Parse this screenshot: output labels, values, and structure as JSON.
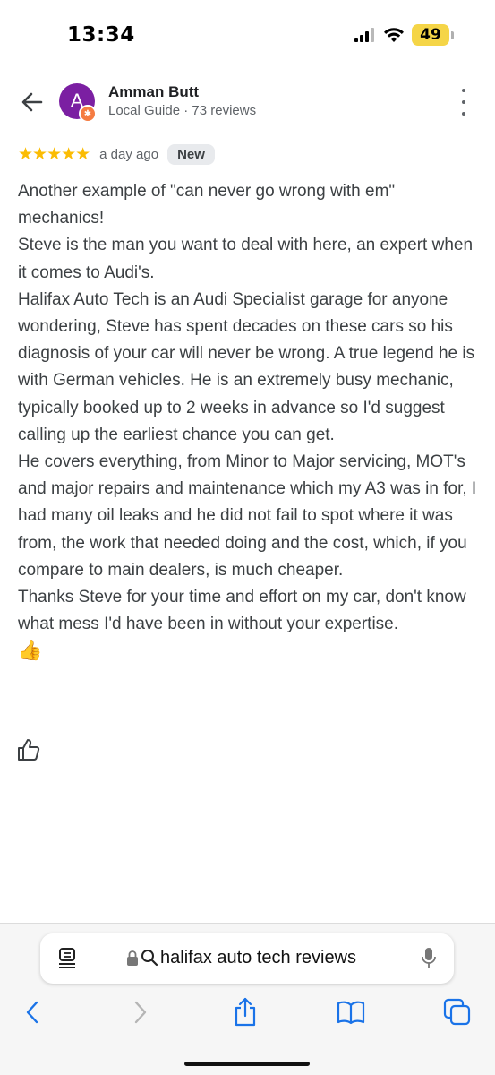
{
  "status_bar": {
    "time": "13:34",
    "battery": "49"
  },
  "reviewer": {
    "avatar_letter": "A",
    "name": "Amman Butt",
    "meta": "Local Guide · 73 reviews"
  },
  "review": {
    "rating": 5,
    "stars_display": "★★★★★",
    "date": "a day ago",
    "badge": "New",
    "paragraphs": [
      "Another example of \"can never go wrong with em\" mechanics!",
      "Steve is the man you want to deal with here, an expert when it comes to Audi's.",
      "Halifax Auto Tech is an Audi Specialist garage for anyone wondering, Steve has spent decades on these cars so his diagnosis of your car will never be wrong. A true legend he is with German vehicles. He is an extremely busy mechanic, typically booked up to 2 weeks in advance so I'd suggest calling up the earliest chance you can get.",
      "He covers everything, from Minor to Major servicing, MOT's and major repairs and maintenance which my A3 was in for, I had many oil leaks and he did not fail to spot where it was from, the work that needed doing and the cost, which, if you compare to main dealers, is much cheaper.",
      "Thanks Steve for your time and effort on my car, don't know what mess I'd have been in without your expertise."
    ],
    "emoji": "👍"
  },
  "browser": {
    "address_text": "halifax auto tech reviews"
  },
  "colors": {
    "avatar": "#7b1fa2",
    "stars": "#fbbc04",
    "badge_bg": "#e8eaed",
    "toolbar_icons": "#1a73e8"
  },
  "icons": {
    "header": [
      "back-arrow-icon",
      "more-vert-icon",
      "local-guide-icon"
    ],
    "actions": [
      "thumbs-up-icon"
    ],
    "address_bar": [
      "reader-icon",
      "lock-icon",
      "search-icon",
      "microphone-icon"
    ],
    "toolbar": [
      "back-icon",
      "forward-icon",
      "share-icon",
      "bookmarks-icon",
      "tabs-icon"
    ]
  }
}
